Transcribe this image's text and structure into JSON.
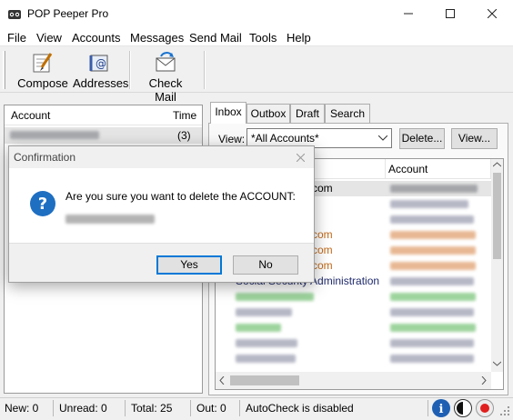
{
  "window": {
    "title": "POP Peeper Pro"
  },
  "menu": [
    "File",
    "View",
    "Accounts",
    "Messages",
    "Send Mail",
    "Tools",
    "Help"
  ],
  "toolbar": {
    "compose": "Compose",
    "addresses": "Addresses",
    "check_mail": "Check Mail"
  },
  "accounts_panel": {
    "col_account": "Account",
    "col_time": "Time",
    "first_row_time": "(3)"
  },
  "tabs": [
    "Inbox",
    "Outbox",
    "Draft",
    "Search"
  ],
  "filter": {
    "label": "View:",
    "value": "*All Accounts*",
    "delete_btn": "Delete...",
    "view_btn": "View..."
  },
  "messages_panel": {
    "col_account": "Account",
    "fragments": {
      "row1": "ft.com",
      "row4": "ft.com",
      "row5": "ft.com",
      "row6": "ft.com",
      "row7": "Social Security Administration"
    }
  },
  "dialog": {
    "title": "Confirmation",
    "message": "Are you sure you want to delete the ACCOUNT:",
    "yes": "Yes",
    "no": "No"
  },
  "status": {
    "new": "New: 0",
    "unread": "Unread: 0",
    "total": "Total: 25",
    "out": "Out: 0",
    "autocheck": "AutoCheck is disabled"
  },
  "colors": {
    "accent": "#0078d7",
    "orange_text": "#c06a1a",
    "navy_text": "#1f2a6b"
  }
}
